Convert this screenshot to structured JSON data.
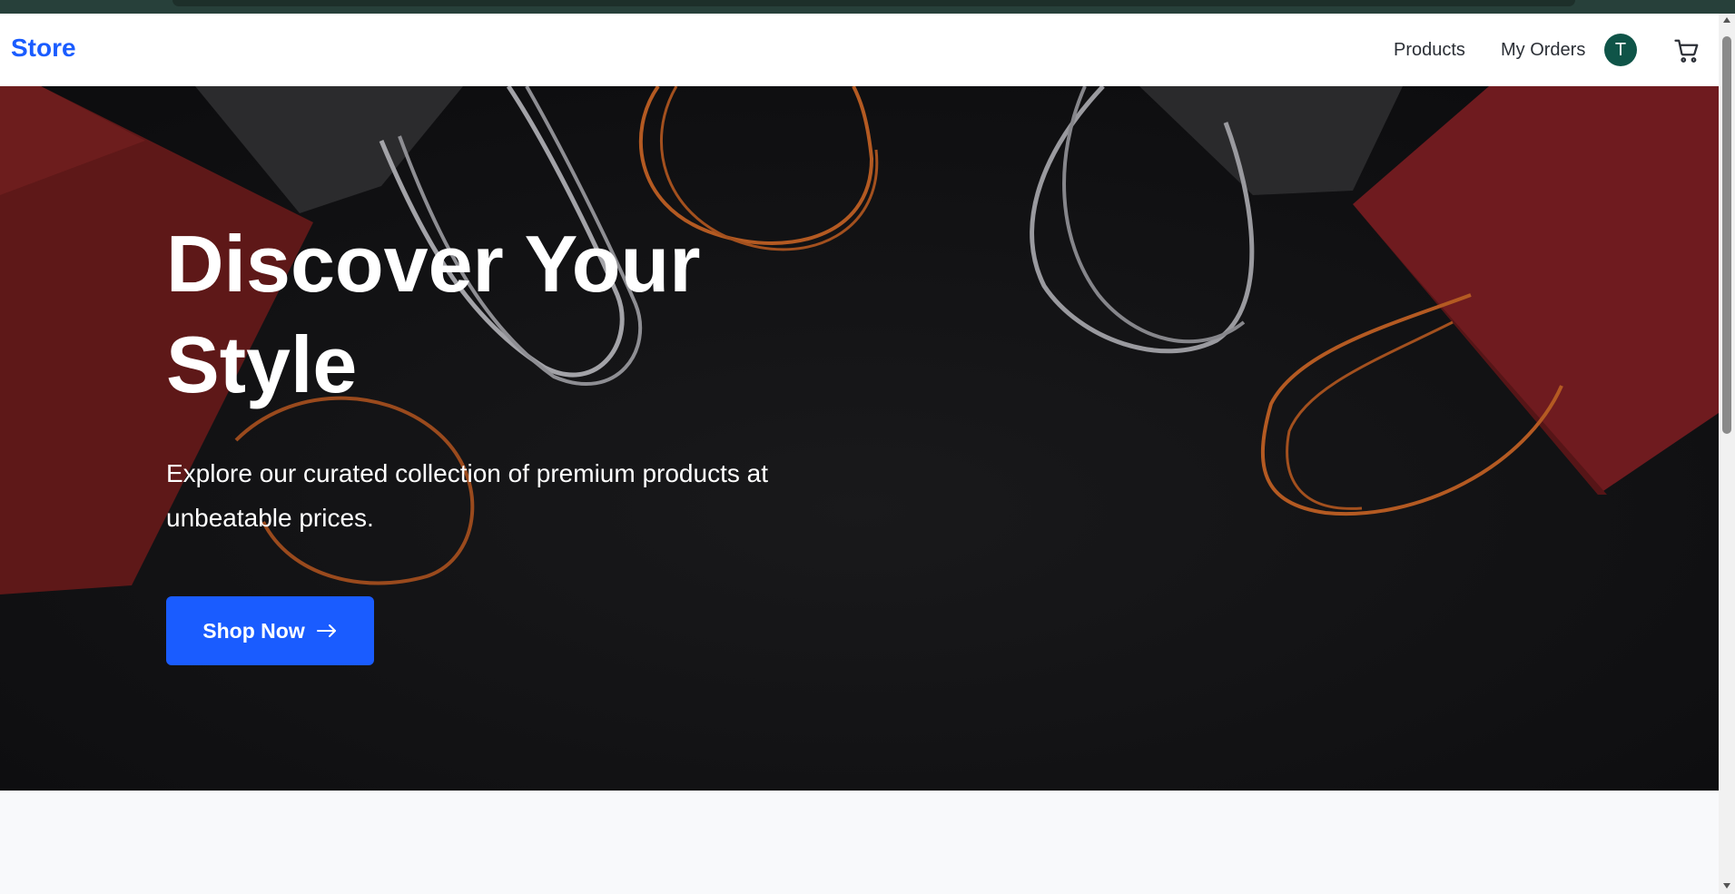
{
  "navbar": {
    "brand": "Store",
    "links": [
      {
        "label": "Products"
      },
      {
        "label": "My Orders"
      }
    ],
    "avatar_initial": "T",
    "cart_icon": "shopping-cart-icon"
  },
  "hero": {
    "title": "Discover Your Style",
    "subtitle": "Explore our curated collection of premium products at unbeatable prices.",
    "cta_label": "Shop Now",
    "cta_icon": "arrow-right-icon",
    "background": "dark-shopping-bags-photo"
  },
  "colors": {
    "brand": "#1a5cff",
    "cta_background": "#1a5cff",
    "avatar_background": "#0f5448",
    "hero_background": "#141416",
    "page_background": "#f8f9fb"
  }
}
